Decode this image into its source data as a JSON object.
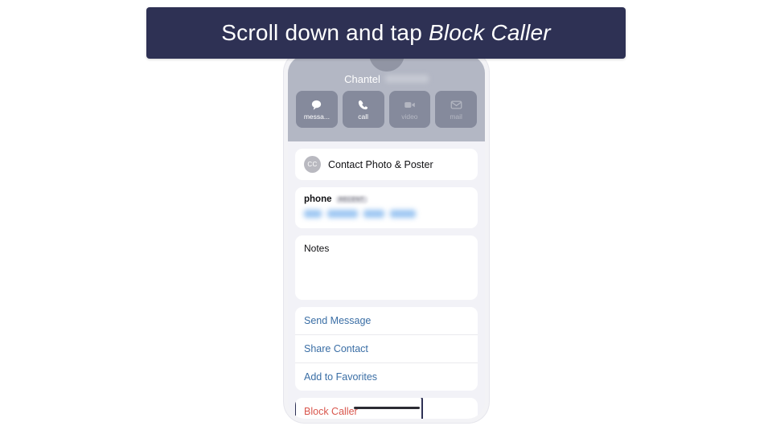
{
  "banner": {
    "text_prefix": "Scroll down and tap ",
    "text_emphasis": "Block Caller",
    "background_color": "#2e3154",
    "text_color": "#ffffff"
  },
  "phone": {
    "contact_header": {
      "first_name": "Chantel",
      "last_name_redacted": "",
      "avatar_initials": "",
      "background_color": "#b3b7c4",
      "actions": [
        {
          "label": "messa...",
          "icon": "message-icon",
          "enabled": true
        },
        {
          "label": "call",
          "icon": "phone-icon",
          "enabled": true
        },
        {
          "label": "video",
          "icon": "video-icon",
          "enabled": false
        },
        {
          "label": "mail",
          "icon": "mail-icon",
          "enabled": false
        }
      ]
    },
    "contact_photo_row": {
      "badge_text": "CC",
      "label": "Contact Photo & Poster"
    },
    "phone_section": {
      "label": "phone",
      "badge": "RECENT",
      "number_redacted": ""
    },
    "notes_section": {
      "label": "Notes",
      "value": ""
    },
    "links": [
      {
        "label": "Send Message"
      },
      {
        "label": "Share Contact"
      },
      {
        "label": "Add to Favorites"
      }
    ],
    "block_row": {
      "label": "Block Caller",
      "text_color": "#d9574e",
      "highlight_color": "#2e3154"
    }
  }
}
